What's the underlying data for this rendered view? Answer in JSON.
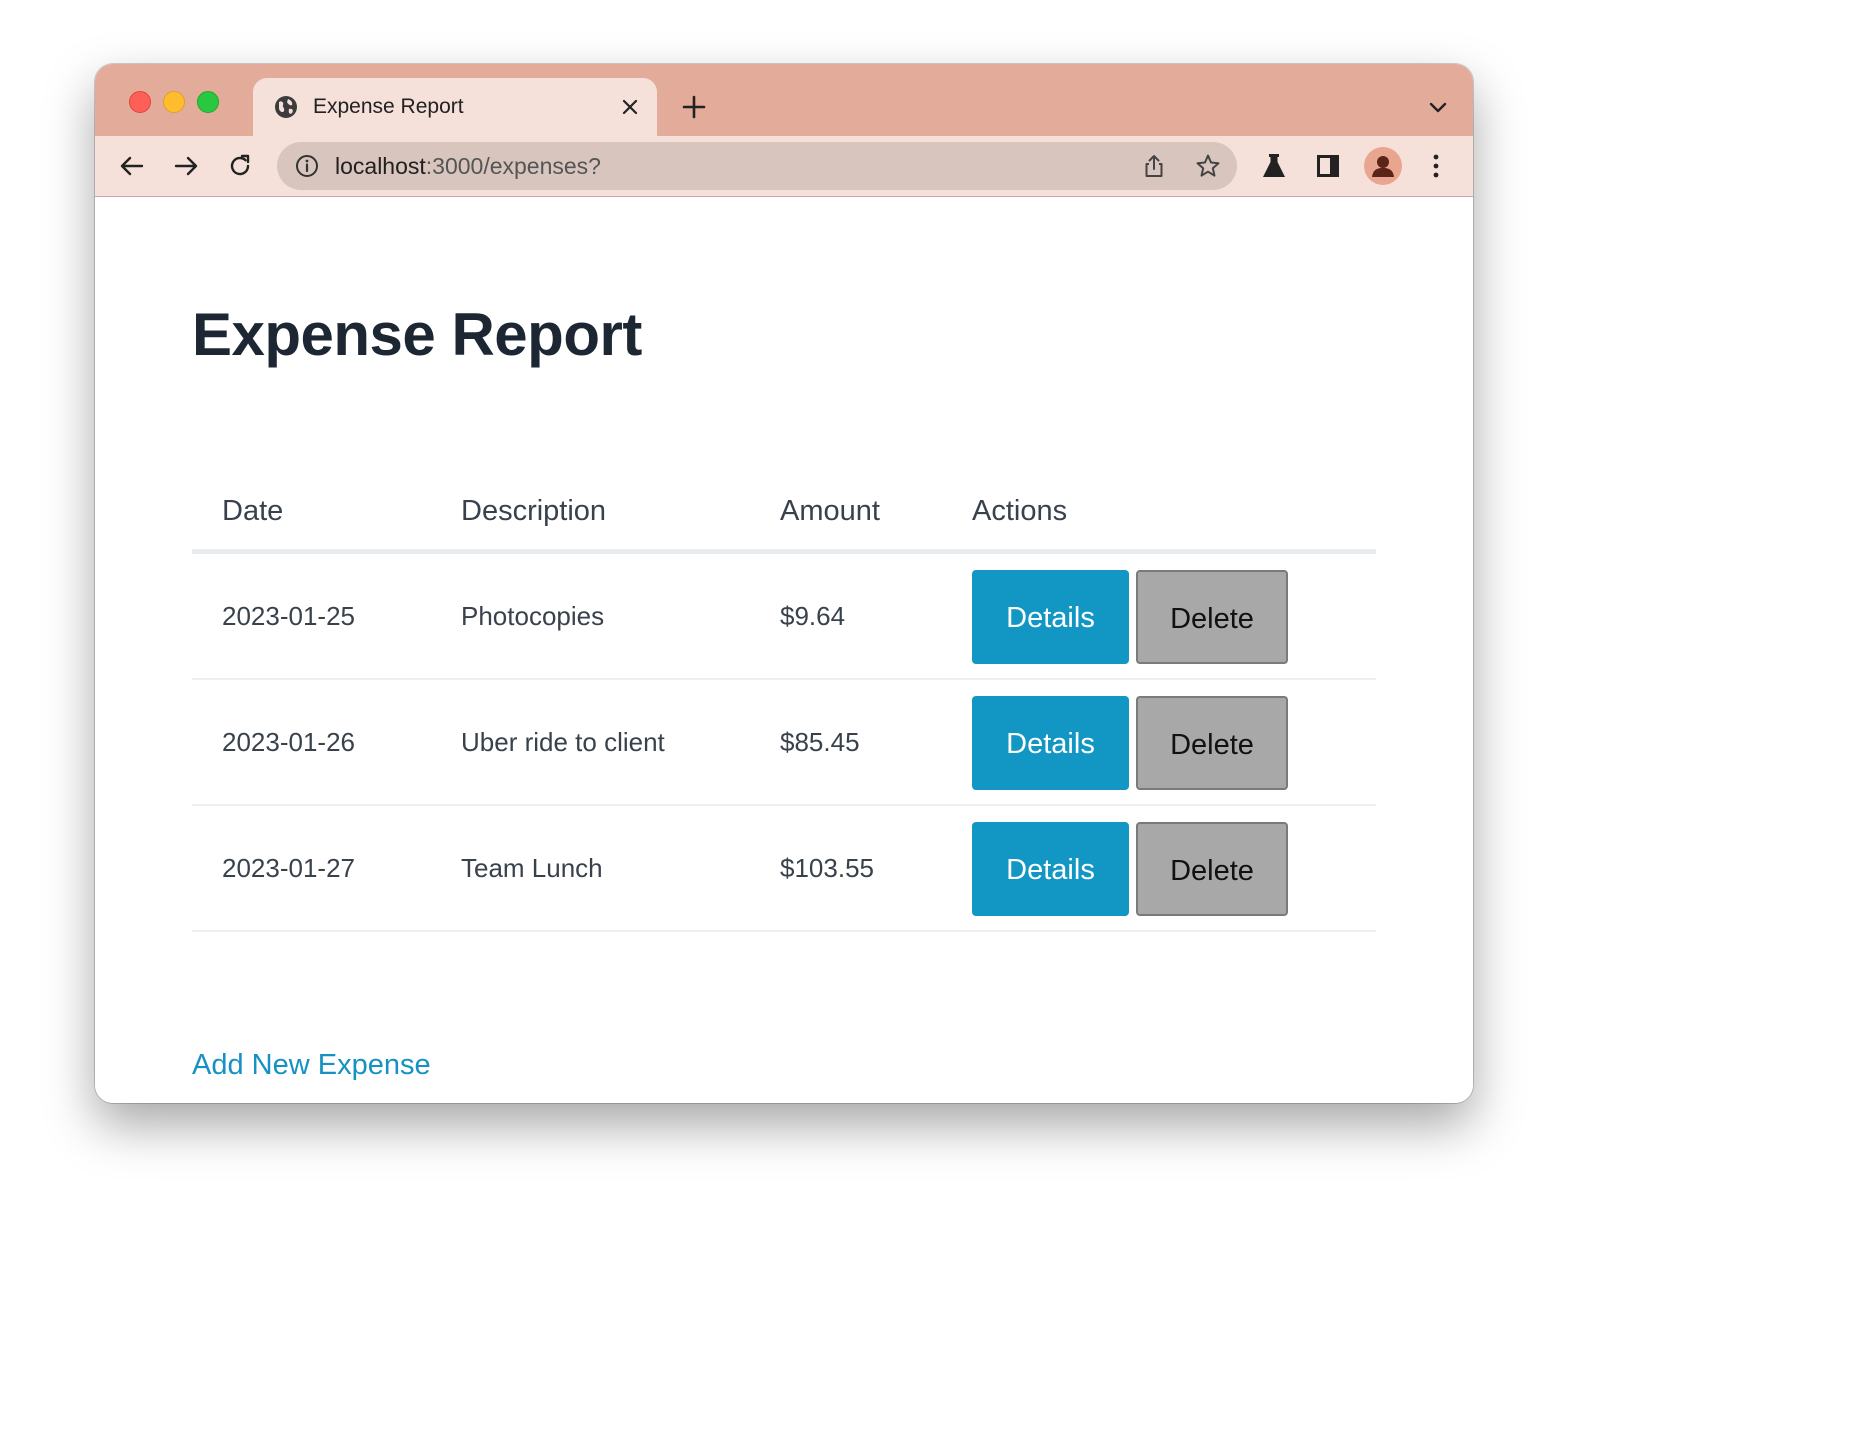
{
  "browser": {
    "tab_title": "Expense Report",
    "url_host": "localhost",
    "url_path": ":3000/expenses?"
  },
  "page": {
    "title": "Expense Report",
    "table": {
      "headers": [
        "Date",
        "Description",
        "Amount",
        "Actions"
      ],
      "rows": [
        {
          "date": "2023-01-25",
          "description": "Photocopies",
          "amount": "$9.64"
        },
        {
          "date": "2023-01-26",
          "description": "Uber ride to client",
          "amount": "$85.45"
        },
        {
          "date": "2023-01-27",
          "description": "Team Lunch",
          "amount": "$103.55"
        }
      ],
      "details_label": "Details",
      "delete_label": "Delete"
    },
    "add_link": "Add New Expense"
  },
  "colors": {
    "tab_strip": "#e3ab9a",
    "toolbar": "#f6e0da",
    "details_button": "#1296c4",
    "delete_button": "#a8a8a8",
    "link": "#1592c2",
    "title_text": "#1c2733"
  },
  "icons": {
    "tab_favicon": "globe-icon",
    "tab_close": "close-icon",
    "new_tab": "plus-icon",
    "tab_menu": "chevron-down-icon",
    "back": "back-arrow-icon",
    "forward": "forward-arrow-icon",
    "reload": "reload-icon",
    "site_info": "info-icon",
    "share": "share-icon",
    "bookmark": "star-icon",
    "labs": "flask-icon",
    "side_panel": "side-panel-icon",
    "profile": "avatar",
    "menu": "kebab-menu-icon"
  }
}
